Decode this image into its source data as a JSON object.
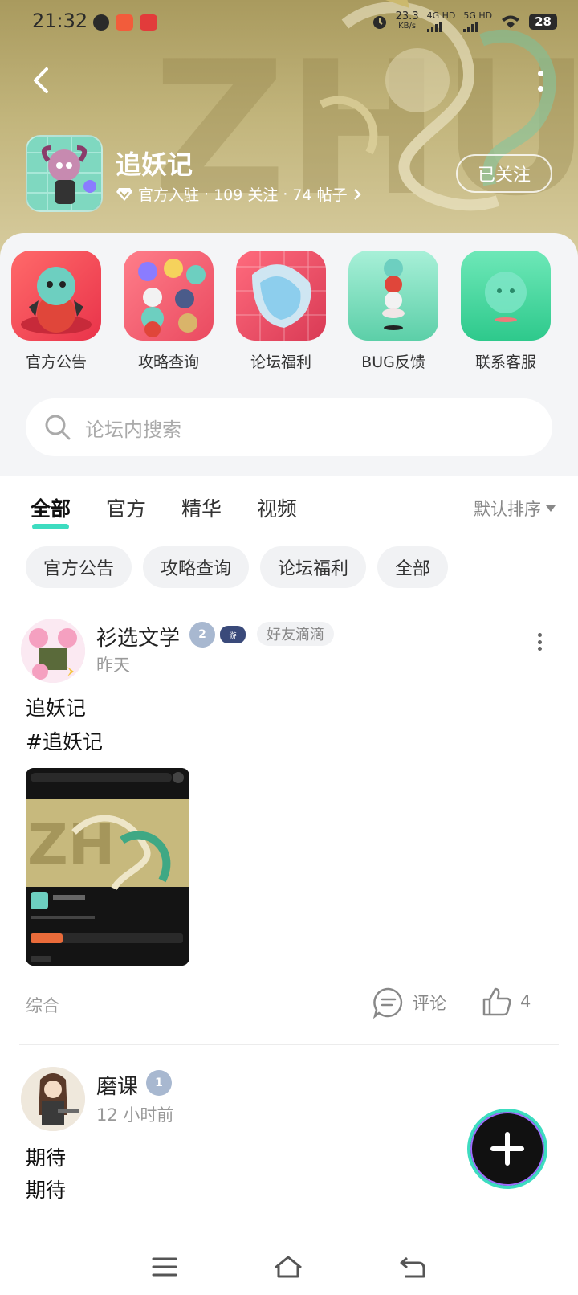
{
  "status": {
    "time": "21:32",
    "speed_value": "23.3",
    "speed_unit": "KB/s",
    "net1": "4G HD",
    "net2": "5G HD",
    "battery": "28"
  },
  "forum": {
    "name": "追妖记",
    "official": "官方入驻",
    "followers": "109 关注",
    "posts": "74 帖子",
    "follow_label": "已关注"
  },
  "shortcuts": [
    {
      "label": "官方公告"
    },
    {
      "label": "攻略查询"
    },
    {
      "label": "论坛福利"
    },
    {
      "label": "BUG反馈"
    },
    {
      "label": "联系客服"
    }
  ],
  "search": {
    "placeholder": "论坛内搜索"
  },
  "tabs": [
    {
      "label": "全部"
    },
    {
      "label": "官方"
    },
    {
      "label": "精华"
    },
    {
      "label": "视频"
    }
  ],
  "sort_label": "默认排序",
  "chips": [
    {
      "label": "官方公告"
    },
    {
      "label": "攻略查询"
    },
    {
      "label": "论坛福利"
    },
    {
      "label": "全部"
    }
  ],
  "posts": [
    {
      "user": "衫选文学",
      "level": "2",
      "tag": "好友滴滴",
      "time": "昨天",
      "title": "追妖记",
      "body": "#追妖记",
      "category": "综合",
      "comment_label": "评论",
      "likes": "4"
    },
    {
      "user": "磨课",
      "level": "1",
      "time": "12 小时前",
      "title": "期待",
      "body": "期待"
    }
  ],
  "colors": {
    "accent": "#3ddcc0",
    "hero": "#b9ab70"
  }
}
